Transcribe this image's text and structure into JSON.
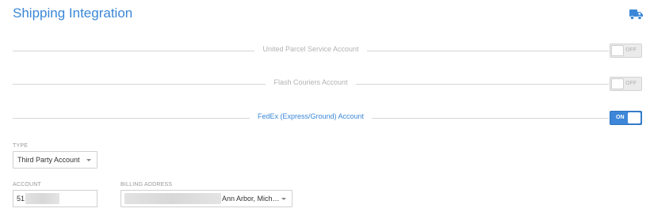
{
  "header": {
    "title": "Shipping Integration",
    "icon": "truck-icon"
  },
  "accounts": [
    {
      "label": "United Parcel Service Account",
      "state": "OFF",
      "enabled": false
    },
    {
      "label": "Flash Couriers Account",
      "state": "OFF",
      "enabled": false
    },
    {
      "label": "FedEx (Express/Ground) Account",
      "state": "ON",
      "enabled": true
    }
  ],
  "form": {
    "type_label": "TYPE",
    "type_value": "Third Party Account",
    "account_label": "ACCOUNT",
    "account_value": "51",
    "billing_label": "BILLING ADDRESS",
    "billing_value": "Ann Arbor, Mich…"
  },
  "colors": {
    "accent": "#3a87d8",
    "toggle_on": "#3d86d8",
    "toggle_off": "#ebebeb"
  }
}
